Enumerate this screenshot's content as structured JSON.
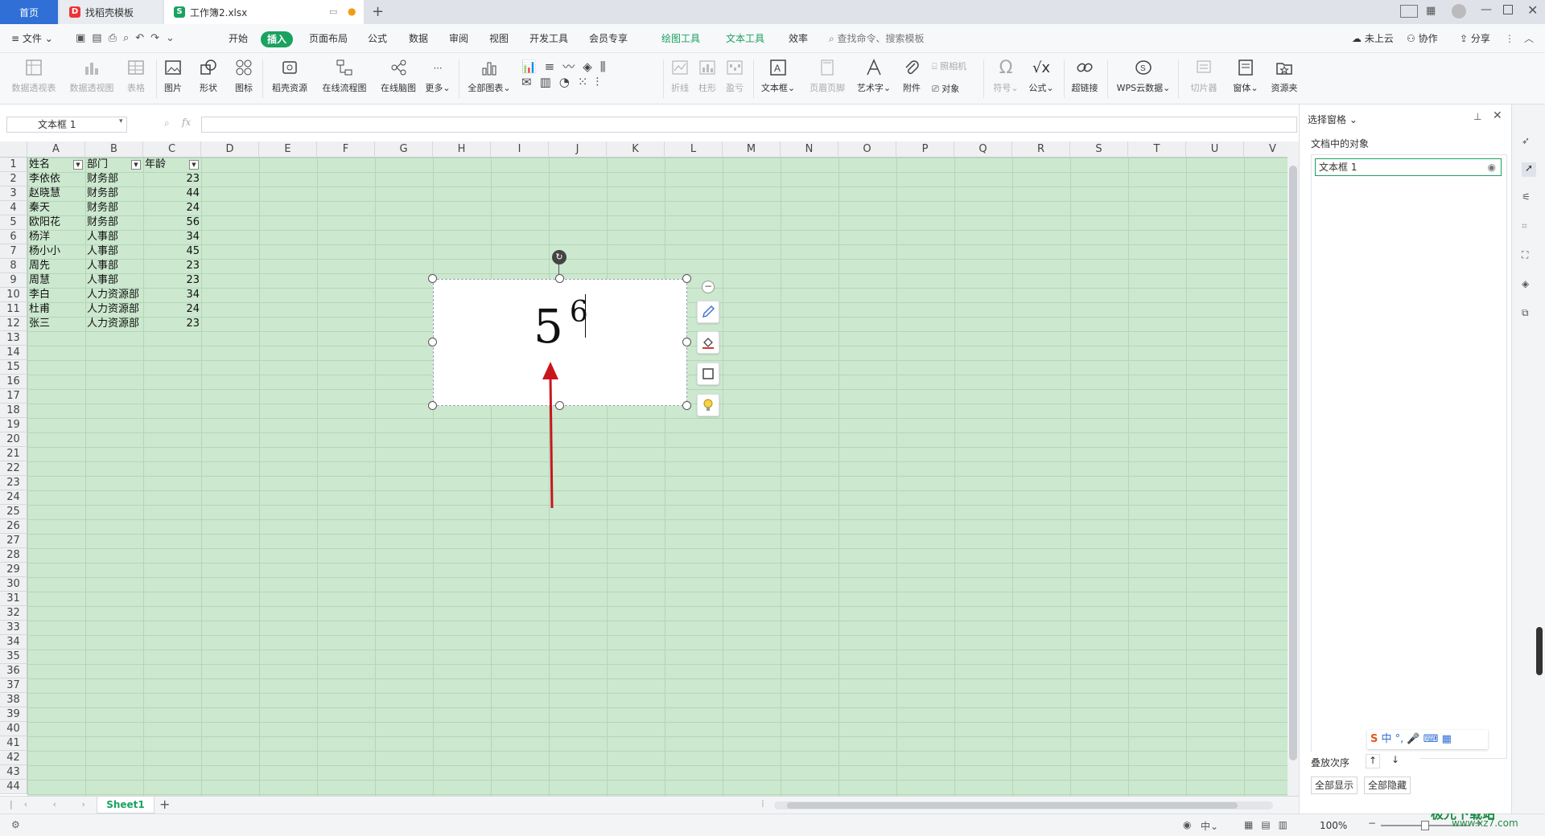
{
  "tabs": {
    "home": "首页",
    "template": "找稻壳模板",
    "document": "工作簿2.xlsx",
    "new_tab": "+"
  },
  "menu": {
    "file": "文件",
    "items": [
      "开始",
      "插入",
      "页面布局",
      "公式",
      "数据",
      "审阅",
      "视图",
      "开发工具",
      "会员专享"
    ],
    "active": "插入",
    "context": [
      "绘图工具",
      "文本工具",
      "效率"
    ],
    "search": "查找命令、搜索模板",
    "right": [
      "未上云",
      "协作",
      "分享"
    ]
  },
  "ribbon": {
    "items": [
      "数据透视表",
      "数据透视图",
      "表格",
      "图片",
      "形状",
      "图标",
      "稻壳资源",
      "在线流程图",
      "在线脑图",
      "更多",
      "全部图表",
      "折线",
      "柱形",
      "盈亏",
      "文本框",
      "页眉页脚",
      "艺术字",
      "附件",
      "对象",
      "符号",
      "公式",
      "超链接",
      "WPS云数据",
      "切片器",
      "窗体",
      "资源夹"
    ],
    "camera": "照相机"
  },
  "namebox": "文本框 1",
  "fx": "fx",
  "columns": [
    "A",
    "B",
    "C",
    "D",
    "E",
    "F",
    "G",
    "H",
    "I",
    "J",
    "K",
    "L",
    "M",
    "N",
    "O",
    "P",
    "Q",
    "R",
    "S",
    "T",
    "U",
    "V"
  ],
  "rows": [
    "1",
    "2",
    "3",
    "4",
    "5",
    "6",
    "7",
    "8",
    "9",
    "10",
    "11",
    "12",
    "13",
    "14",
    "15",
    "16",
    "17",
    "18",
    "19",
    "20",
    "21",
    "22",
    "23",
    "24",
    "25",
    "26",
    "27",
    "28",
    "29",
    "30",
    "31",
    "32",
    "33",
    "34",
    "35",
    "36",
    "37",
    "38",
    "39",
    "40",
    "41",
    "42",
    "43",
    "44"
  ],
  "table": {
    "headers": [
      "姓名",
      "部门",
      "年龄"
    ],
    "rows": [
      [
        "李依依",
        "财务部",
        "23"
      ],
      [
        "赵晓慧",
        "财务部",
        "44"
      ],
      [
        "秦天",
        "财务部",
        "24"
      ],
      [
        "欧阳花",
        "财务部",
        "56"
      ],
      [
        "杨洋",
        "人事部",
        "34"
      ],
      [
        "杨小小",
        "人事部",
        "45"
      ],
      [
        "周先",
        "人事部",
        "23"
      ],
      [
        "周慧",
        "人事部",
        "23"
      ],
      [
        "李白",
        "人力资源部",
        "34"
      ],
      [
        "杜甫",
        "人力资源部",
        "24"
      ],
      [
        "张三",
        "人力资源部",
        "23"
      ]
    ]
  },
  "textbox": {
    "base": "5",
    "exponent": "6"
  },
  "sheet": {
    "name": "Sheet1",
    "add": "+"
  },
  "panel": {
    "title": "选择窗格",
    "objects_label": "文档中的对象",
    "object": "文本框 1",
    "order_label": "叠放次序",
    "show_all": "全部显示",
    "hide_all": "全部隐藏"
  },
  "status": {
    "zoom": "100%",
    "ime": "中",
    "watermark": "极光下载站",
    "watermark_url": "www.xz7.com"
  },
  "colors": {
    "accent": "#1aa261",
    "cell_bg": "#cce8cf",
    "tab_active": "#2f6fd6",
    "arrow": "#c8161d"
  }
}
